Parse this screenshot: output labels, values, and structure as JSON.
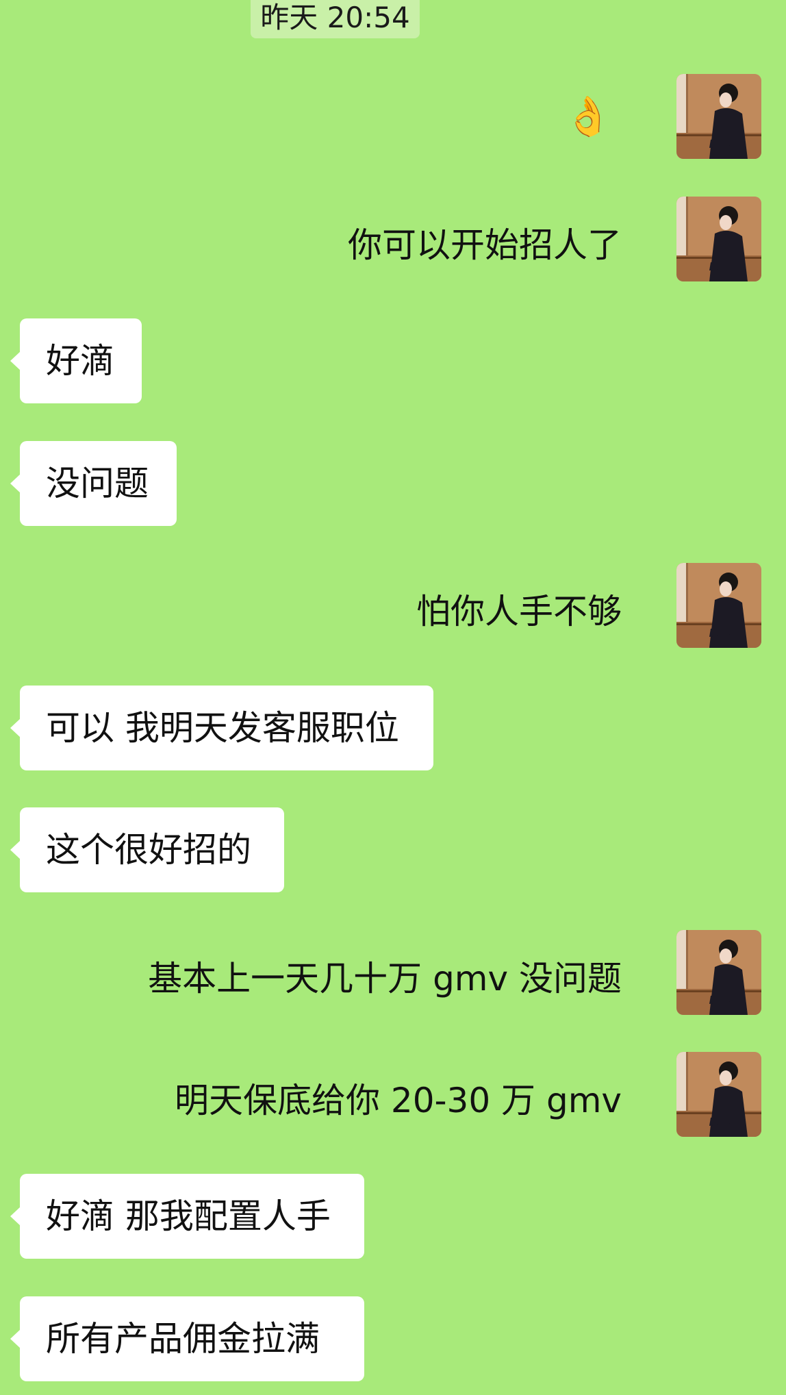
{
  "timestamp": "昨天 20:54",
  "avatar_icon": "woman-portrait-avatar",
  "messages": [
    {
      "side": "sent",
      "type": "emoji",
      "text": "👌"
    },
    {
      "side": "sent",
      "type": "text",
      "text": "你可以开始招人了"
    },
    {
      "side": "received",
      "type": "text",
      "text": "好滴"
    },
    {
      "side": "received",
      "type": "text",
      "text": "没问题"
    },
    {
      "side": "sent",
      "type": "text",
      "text": "怕你人手不够"
    },
    {
      "side": "received",
      "type": "text",
      "text": "可以 我明天发客服职位"
    },
    {
      "side": "received",
      "type": "text",
      "text": "这个很好招的"
    },
    {
      "side": "sent",
      "type": "text",
      "text": "基本上一天几十万 gmv 没问题"
    },
    {
      "side": "sent",
      "type": "text",
      "text": "明天保底给你 20-30 万 gmv"
    },
    {
      "side": "received",
      "type": "text",
      "text": "好滴 那我配置人手"
    },
    {
      "side": "received",
      "type": "text",
      "text": "所有产品佣金拉满"
    }
  ],
  "colors": {
    "chat_background": "#a8ea7a",
    "received_bubble": "#ffffff",
    "timestamp_background": "#c9f0a8"
  }
}
